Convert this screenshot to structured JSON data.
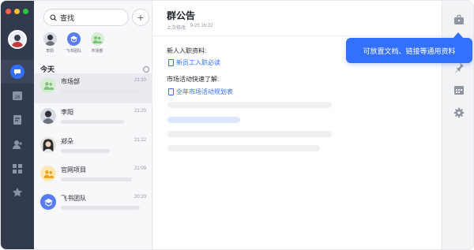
{
  "window": {
    "traffic_colors": [
      "#ff5f57",
      "#febc2e",
      "#28c840"
    ]
  },
  "rail": {
    "items": [
      {
        "icon": "chat-icon",
        "active": true
      },
      {
        "icon": "calendar-icon",
        "label": "26"
      },
      {
        "icon": "docs-icon"
      },
      {
        "icon": "contacts-icon"
      },
      {
        "icon": "apps-icon"
      },
      {
        "icon": "star-icon"
      }
    ]
  },
  "search": {
    "placeholder": "查找"
  },
  "pinned": [
    {
      "name": "李阳",
      "color": "#d6dae2"
    },
    {
      "name": "飞书团队",
      "color": "#5b7cf0"
    },
    {
      "name": "市场部",
      "color": "#d8ebd5"
    }
  ],
  "section": {
    "label": "今天"
  },
  "chats": [
    {
      "name": "市场部",
      "time": "21:10",
      "color": "#d8ebd5",
      "active": true
    },
    {
      "name": "李阳",
      "time": "21:20",
      "color": "#d6dae2"
    },
    {
      "name": "郑朵",
      "time": "21:12",
      "color": "#e5e1dc"
    },
    {
      "name": "官网项目",
      "time": "21:09",
      "color": "#fde8b3"
    },
    {
      "name": "飞书团队",
      "time": "20:20",
      "color": "#5b7cf0"
    }
  ],
  "announcement": {
    "title": "群公告",
    "subtitle_prefix": "上次修改:",
    "subtitle_time": "9-25 16:22",
    "section1": "新人入职资料:",
    "link1": "新员工入职必读",
    "section2": "市场活动快速了解:",
    "link2": "全年市场活动规划表"
  },
  "right_rail": {
    "icons": [
      "briefcase-icon",
      "pin-icon",
      "calendar-grid-icon",
      "settings-icon"
    ]
  },
  "tooltip": {
    "text": "可放置文档、链接等通用资料"
  },
  "colors": {
    "accent": "#3370ff",
    "rail": "#323a4d"
  }
}
